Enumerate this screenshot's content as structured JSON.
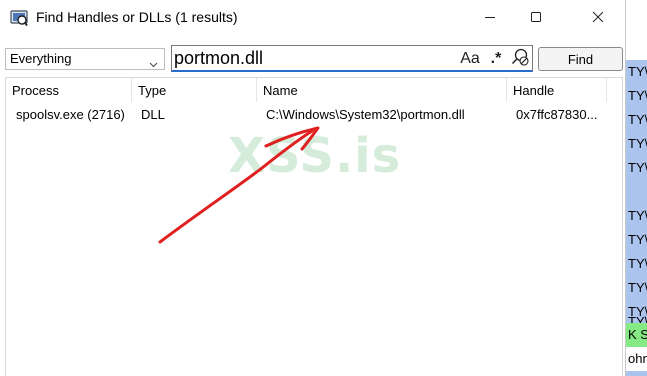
{
  "window": {
    "title": "Find Handles or DLLs (1 results)",
    "icon": "process-explorer-icon",
    "controls": [
      "minimize-icon",
      "maximize-icon",
      "close-icon"
    ]
  },
  "search": {
    "type_filter": "Everything",
    "query": "portmon.dll",
    "options": [
      "Aa",
      ".*"
    ],
    "find_label": "Find"
  },
  "table": {
    "columns": [
      "Process",
      "Type",
      "Name",
      "Handle"
    ],
    "rows": [
      {
        "process": "spoolsv.exe (2716)",
        "type": "DLL",
        "name": "C:\\Windows\\System32\\portmon.dll",
        "handle": "0x7ffc87830..."
      }
    ]
  },
  "background_window": {
    "cells": [
      "TY\\",
      "TY\\",
      "TY\\",
      "TY\\",
      "TY\\",
      "TY\\",
      "TY\\",
      "TY\\",
      "TY\\",
      "TY\\",
      "TY\\",
      "K S",
      "ohnA"
    ],
    "highlight_color": "#aac4ee",
    "green_cell_color": "#86ea84"
  },
  "overlay": {
    "watermark": "XSS.is",
    "annotation_color": "#e02020"
  }
}
